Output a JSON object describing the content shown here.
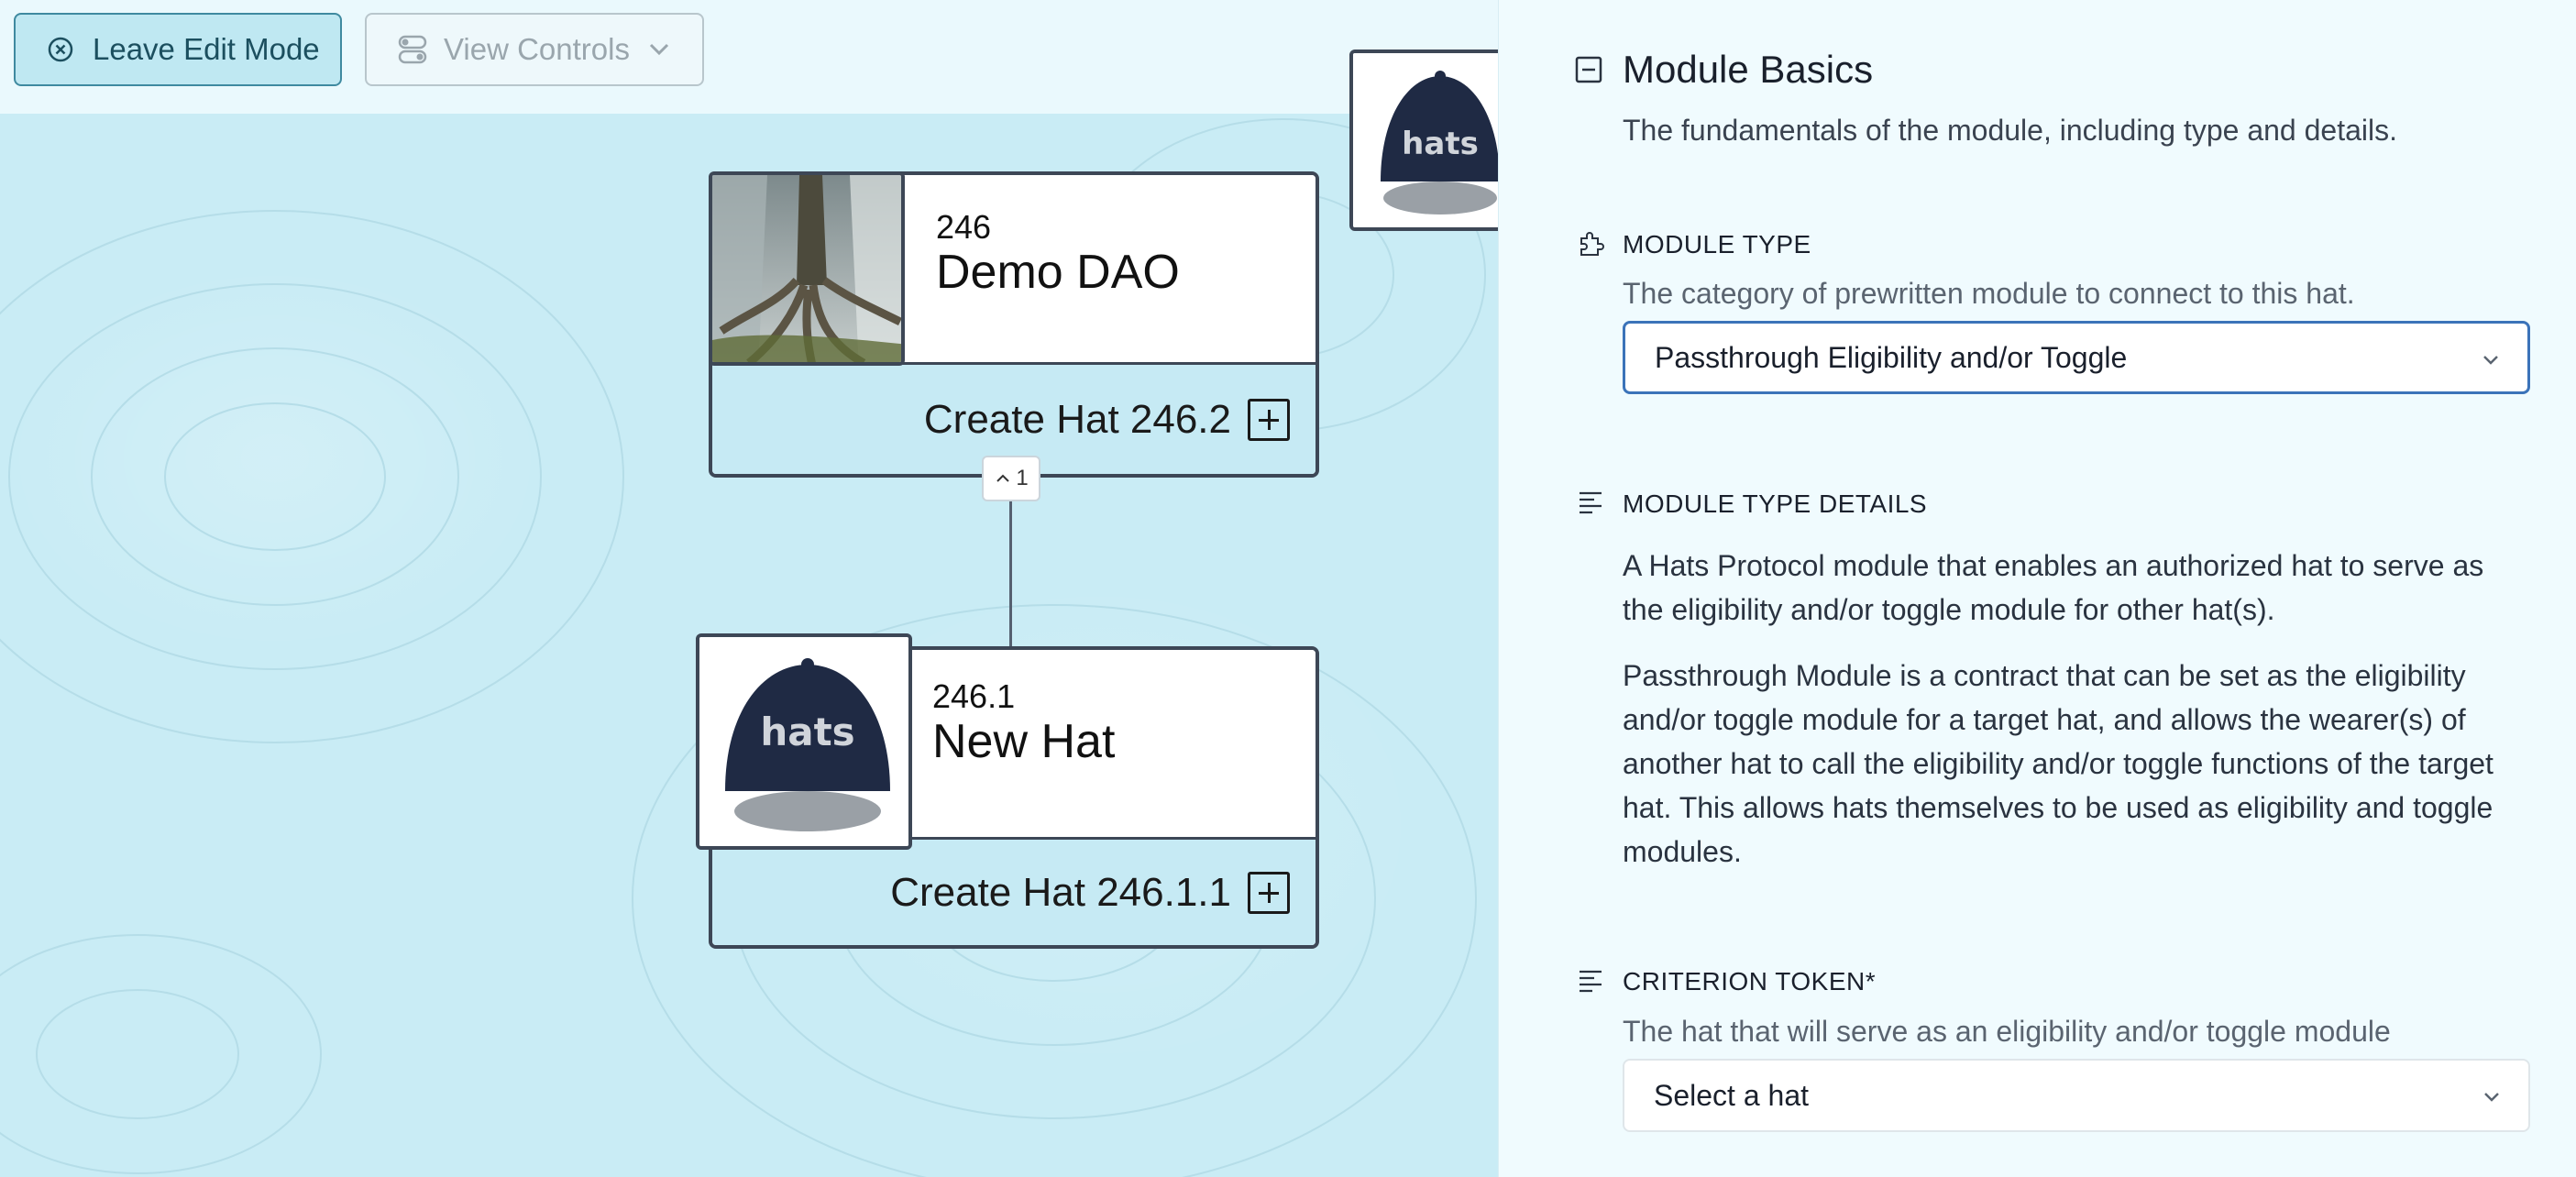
{
  "toolbar": {
    "leave_edit_label": "Leave Edit Mode",
    "view_controls_label": "View Controls"
  },
  "tree": {
    "root_hat": {
      "id": "246",
      "name": "Demo DAO",
      "create_label": "Create Hat 246.2"
    },
    "child_hat": {
      "id": "246.1",
      "name": "New Hat",
      "create_label": "Create Hat 246.1.1"
    },
    "collapse_badge": "1",
    "cap_logo_text": "hats"
  },
  "panel": {
    "title": "Module Basics",
    "subtitle": "The fundamentals of the module, including type and details.",
    "module_type": {
      "label": "MODULE TYPE",
      "help": "The category of prewritten module to connect to this hat.",
      "selected": "Passthrough Eligibility and/or Toggle"
    },
    "module_type_details": {
      "label": "MODULE TYPE DETAILS",
      "line1a": "A Hats Protocol module that enables an authorized hat to serve as",
      "line1b": "the eligibility and/or toggle module for other hat(s).",
      "line2a": "Passthrough Module is a contract that can be set as the eligibility",
      "line2b": "and/or toggle module for a target hat, and allows the wearer(s) of",
      "line2c": "another hat to call the eligibility and/or toggle functions of the target",
      "line2d": "hat. This allows hats themselves to be used as eligibility and toggle",
      "line2e": "modules."
    },
    "criterion_token": {
      "label": "CRITERION TOKEN*",
      "help": "The hat that will serve as an eligibility and/or toggle module",
      "placeholder": "Select a hat"
    }
  },
  "colors": {
    "canvas_bg": "#c9ecf5",
    "panel_bg": "#f0fbfe",
    "card_border": "#3d4756",
    "select_focus": "#3b73b9"
  }
}
